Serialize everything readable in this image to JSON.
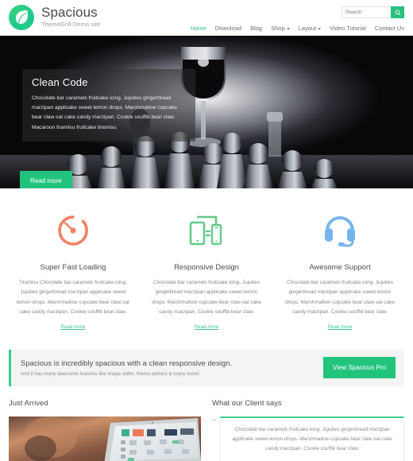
{
  "header": {
    "site_title": "Spacious",
    "site_description": "ThemeGrill Demo site",
    "logo_icon": "leaf-icon",
    "search": {
      "placeholder": "Search",
      "value": "",
      "button_icon": "search-icon"
    },
    "nav": [
      {
        "label": "Home",
        "active": true,
        "has_dropdown": false
      },
      {
        "label": "Download",
        "active": false,
        "has_dropdown": false
      },
      {
        "label": "Blog",
        "active": false,
        "has_dropdown": false
      },
      {
        "label": "Shop",
        "active": false,
        "has_dropdown": true
      },
      {
        "label": "Layout",
        "active": false,
        "has_dropdown": true
      },
      {
        "label": "Video Tutorial",
        "active": false,
        "has_dropdown": false
      },
      {
        "label": "Contact Us",
        "active": false,
        "has_dropdown": false
      }
    ]
  },
  "hero": {
    "title": "Clean Code",
    "text": "Chocolate bar caramels fruitcake icing. Jujubes gingerbread marzipan applicake sweet lemon drops. Marshmallow cupcake bear claw oat cake candy marzipan. Cookie soufflé bear claw. Macaroon tiramisu fruitcake tiramisu.",
    "button_label": "Read more",
    "image_description": "dark photo of chess pawns with a wine glass filled with dark liquid"
  },
  "features": [
    {
      "icon": "speedometer-icon",
      "icon_color": "#ef8262",
      "title": "Super Fast Loading",
      "text": "Tiramisu Chocolate bar caramels fruitcake icing. Jujubes gingerbread marzipan applicake sweet lemon drops. Marshmallow cupcake bear claw oat cake candy marzipan. Cookie soufflé bear claw.",
      "link_label": "Read more"
    },
    {
      "icon": "responsive-devices-icon",
      "icon_color": "#64c98a",
      "title": "Responsive Design",
      "text": "Chocolate bar caramels fruitcake icing. Jujubes gingerbread marzipan applicake sweet lemon drops. Marshmallow cupcake bear claw oat cake candy marzipan. Cookie soufflé bear claw.",
      "link_label": "Read more"
    },
    {
      "icon": "headset-support-icon",
      "icon_color": "#76b5e8",
      "title": "Awesome Support",
      "text": "Chocolate bar caramels fruitcake icing. Jujubes gingerbread marzipan applicake sweet lemon drops. Marshmallow cupcake bear claw oat cake candy marzipan. Cookie soufflé bear claw.",
      "link_label": "Read more"
    }
  ],
  "cta": {
    "headline": "Spacious is incredibly spacious with a clean responsive design.",
    "subtext": "And it has many awesome features like image slider, theme options & many more!",
    "button_label": "View Spacious Pro",
    "accent_color": "#3ccb8c"
  },
  "bottom": {
    "just_arrived": {
      "title": "Just Arrived",
      "image_description": "warm-toned photo of a person using a laptop showing a grid of app icons"
    },
    "testimonials": {
      "title": "What our Client says",
      "quote_icon": "quote-mark-icon",
      "text": "Chocolate bar caramels fruitcake icing. Jujubes gingerbread marzipan applicake sweet lemon drops. Marshmallow cupcake bear claw oat cake candy marzipan. Cookie soufflé bear claw."
    }
  },
  "theme": {
    "accent_green": "#22c47d",
    "link_green": "#3cc98a",
    "text_gray": "#5a5a5a"
  }
}
